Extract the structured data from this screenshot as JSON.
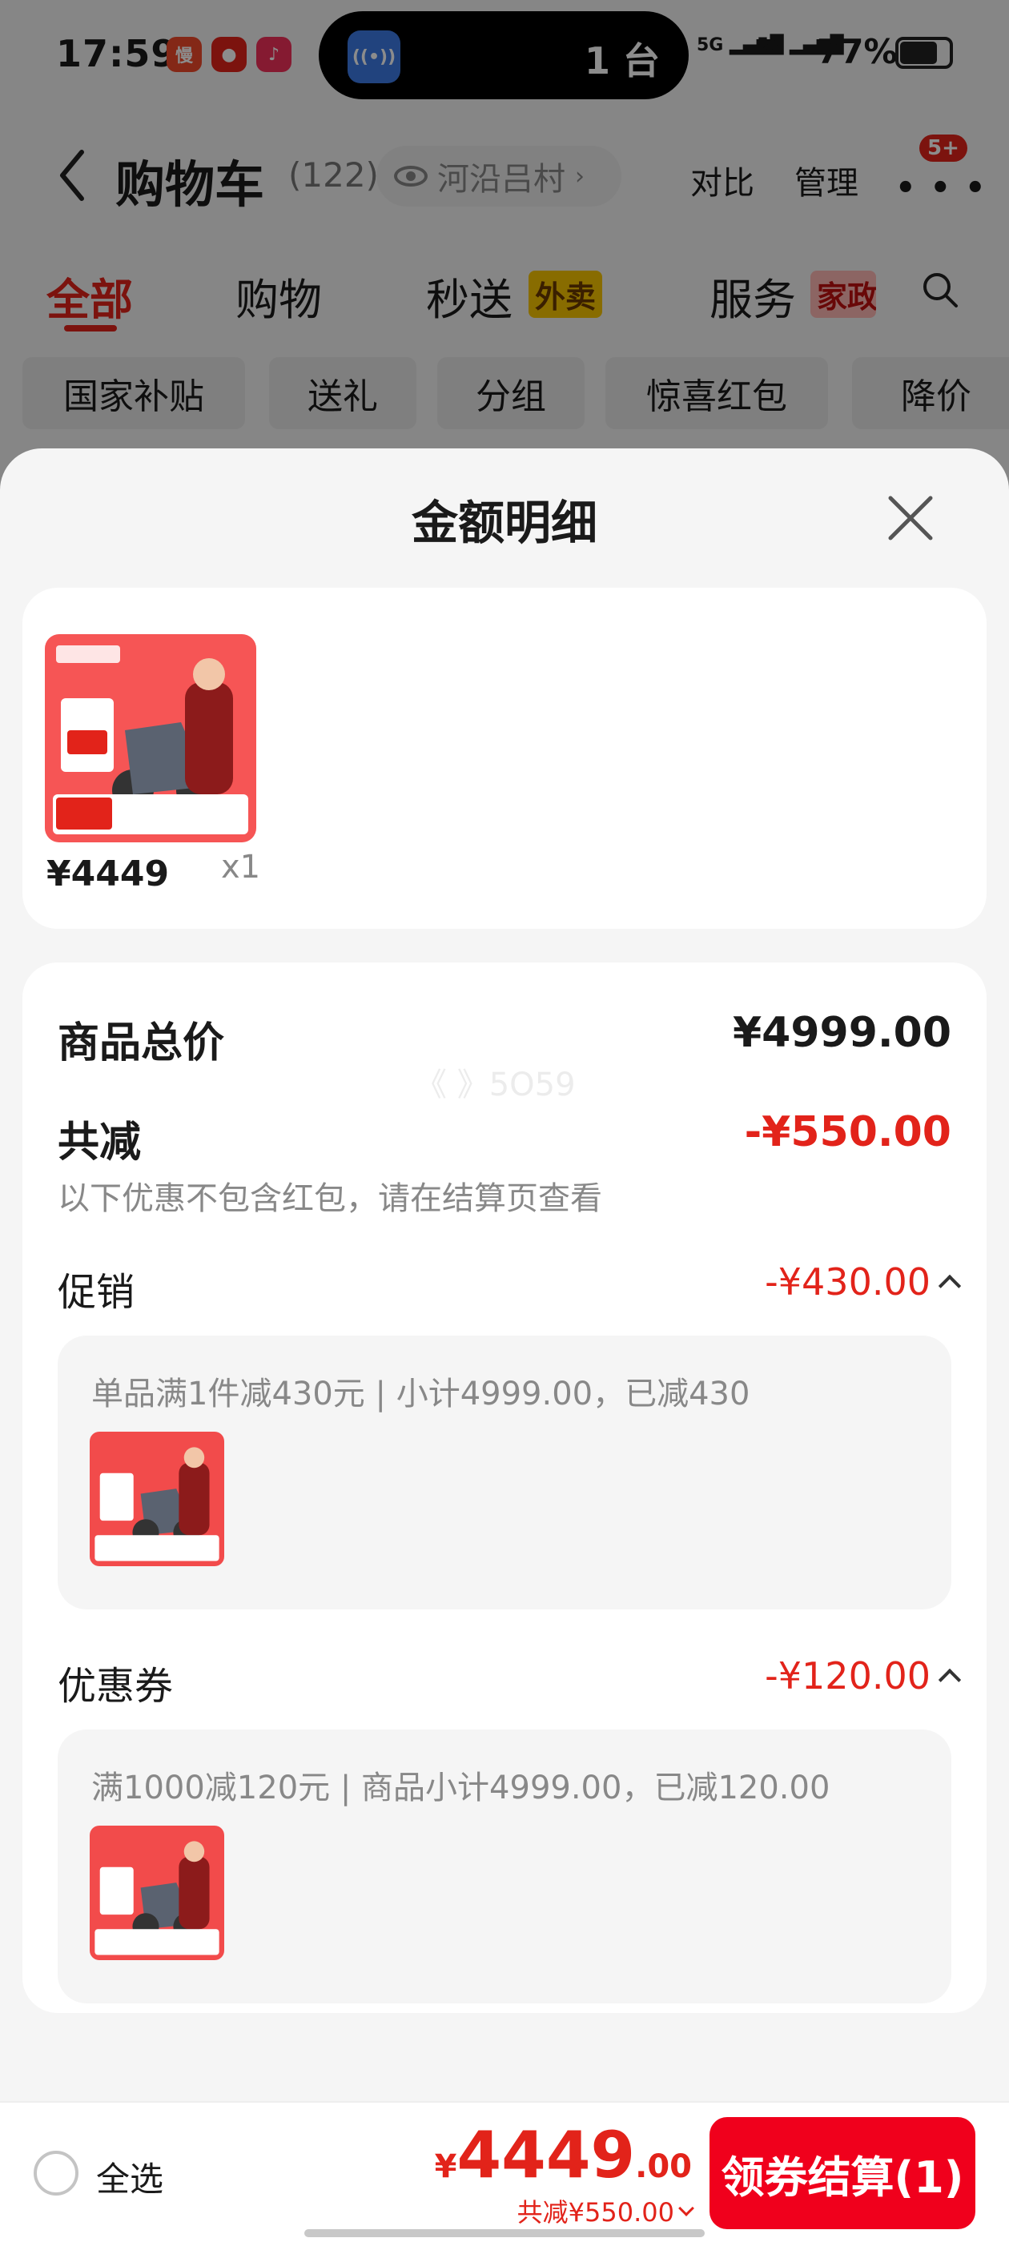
{
  "status_bar": {
    "time": "17:59",
    "island_text": "1 台",
    "island_app_badge": "1",
    "signal_1": "5G",
    "signal_2": "5G",
    "battery": "77%"
  },
  "cart_header": {
    "title": "购物车",
    "count": "(122)",
    "location": "河沿吕村",
    "compare": "对比",
    "manage": "管理",
    "message_badge": "5+"
  },
  "category_tabs": [
    {
      "label": "全部",
      "active": true
    },
    {
      "label": "购物",
      "active": false
    },
    {
      "label": "秒送",
      "tag": "外卖",
      "active": false
    },
    {
      "label": "服务",
      "tag": "家政",
      "active": false
    }
  ],
  "filter_chips": [
    "国家补贴",
    "送礼",
    "分组",
    "惊喜红包",
    "降价"
  ],
  "sheet": {
    "title": "金额明细",
    "items": [
      {
        "price": "¥4449",
        "qty": "x1"
      }
    ],
    "summary": {
      "total_label": "商品总价",
      "total_value": "¥4999.00",
      "reduce_label": "共减",
      "reduce_value": "-¥550.00",
      "note": "以下优惠不包含红包，请在结算页查看"
    },
    "promotion": {
      "label": "促销",
      "value": "-¥430.00",
      "detail": "单品满1件减430元 | 小计4999.00，已减430"
    },
    "coupon": {
      "label": "优惠券",
      "value": "-¥120.00",
      "detail": "满1000减120元 | 商品小计4999.00，已减120.00"
    },
    "watermark": "《 》5O59"
  },
  "bottom_bar": {
    "select_all": "全选",
    "currency": "¥",
    "total_int": "4449",
    "total_dec": ".00",
    "reduce_text": "共减¥550.00",
    "checkout": "领券结算(1)"
  },
  "colors": {
    "accent_red": "#e2231a",
    "checkout_red": "#f0001c",
    "tag_yellow": "#f7c500"
  }
}
